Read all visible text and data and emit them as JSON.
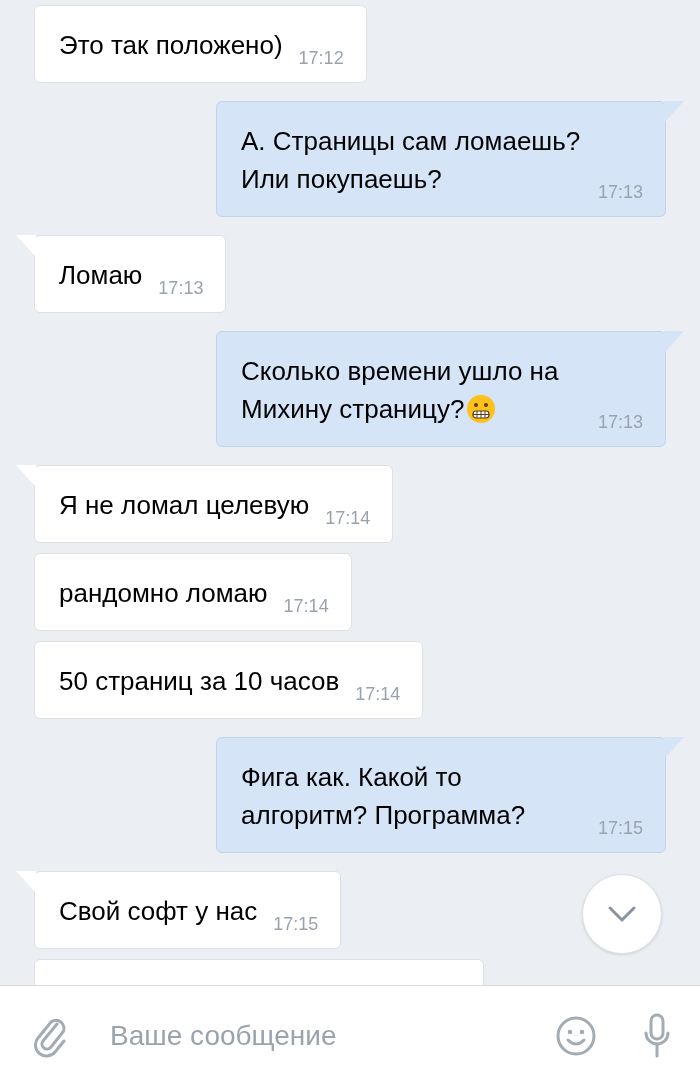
{
  "messages": [
    {
      "kind": "incoming",
      "tail": false,
      "text": "Это так положено)",
      "time": "17:12"
    },
    {
      "kind": "outgoing",
      "tail": true,
      "text": "А. Страницы сам ломаешь? Или покупаешь?",
      "time": "17:13"
    },
    {
      "kind": "incoming",
      "tail": true,
      "text": "Ломаю",
      "time": "17:13"
    },
    {
      "kind": "outgoing",
      "tail": true,
      "text": "Сколько времени ушло на Михину страницу?",
      "has_emoji": true,
      "time": "17:13"
    },
    {
      "kind": "incoming",
      "tail": true,
      "text": "Я не ломал целевую",
      "time": "17:14"
    },
    {
      "kind": "incoming",
      "tail": false,
      "text": "рандомно ломаю",
      "time": "17:14"
    },
    {
      "kind": "incoming",
      "tail": false,
      "text": "50 страниц за 10 часов",
      "time": "17:14"
    },
    {
      "kind": "outgoing",
      "tail": true,
      "text": "Фига как. Какой то алгоритм? Программа?",
      "time": "17:15"
    },
    {
      "kind": "incoming",
      "tail": true,
      "text": "Свой софт у нас",
      "time": "17:15"
    },
    {
      "kind": "incoming",
      "tail": false
    }
  ],
  "composer": {
    "placeholder": "Ваше сообщение"
  }
}
